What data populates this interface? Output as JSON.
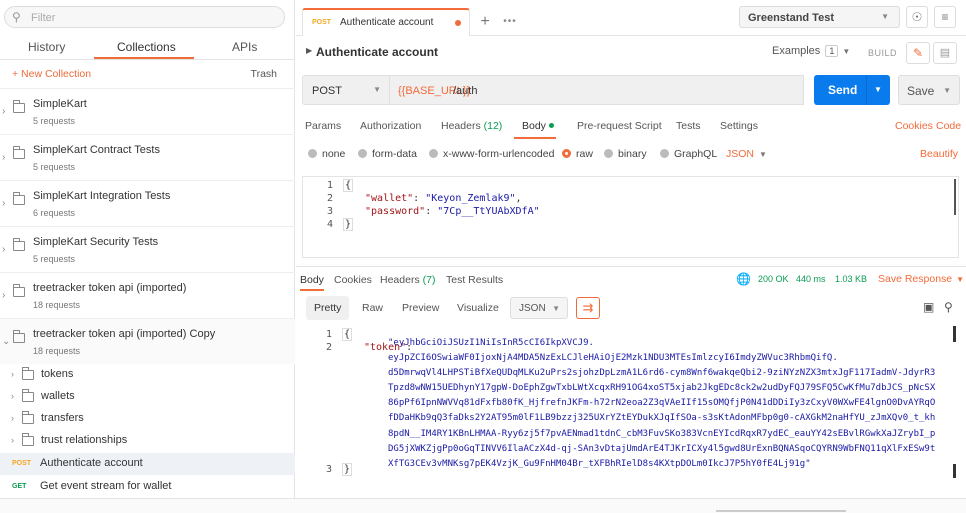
{
  "sidebar": {
    "search_placeholder": "Filter",
    "tabs": [
      "History",
      "Collections",
      "APIs"
    ],
    "new_collection": "+ New Collection",
    "trash": "Trash",
    "collections": [
      {
        "name": "SimpleKart",
        "meta": "5 requests"
      },
      {
        "name": "SimpleKart Contract Tests",
        "meta": "5 requests"
      },
      {
        "name": "SimpleKart Integration Tests",
        "meta": "6 requests"
      },
      {
        "name": "SimpleKart Security Tests",
        "meta": "5 requests"
      },
      {
        "name": "treetracker token api (imported)",
        "meta": "18 requests"
      },
      {
        "name": "treetracker token api (imported) Copy",
        "meta": "18 requests"
      }
    ],
    "folders": [
      "tokens",
      "wallets",
      "transfers",
      "trust relationships"
    ],
    "requests": [
      {
        "method": "POST",
        "name": "Authenticate account"
      },
      {
        "method": "GET",
        "name": "Get event stream for wallet"
      }
    ]
  },
  "topbar": {
    "tab_method": "POST",
    "tab_title": "Authenticate account",
    "add_tab": "+",
    "more_tabs": "•••",
    "environment": "Greenstand Test"
  },
  "request": {
    "title": "Authenticate account",
    "examples_label": "Examples",
    "examples_count": "1",
    "build_label": "BUILD",
    "method": "POST",
    "url_var": "{{BASE_URL}}",
    "url_path": "/auth",
    "send": "Send",
    "save": "Save",
    "tabs": {
      "params": "Params",
      "authorization": "Authorization",
      "headers": "Headers",
      "headers_count": "(12)",
      "body": "Body",
      "prerequest": "Pre-request Script",
      "tests": "Tests",
      "settings": "Settings",
      "cookies": "Cookies",
      "code": "Code"
    },
    "body_types": {
      "none": "none",
      "form_data": "form-data",
      "urlencoded": "x-www-form-urlencoded",
      "raw": "raw",
      "binary": "binary",
      "graphql": "GraphQL",
      "format": "JSON",
      "beautify": "Beautify"
    },
    "body_lines": {
      "l1": "{",
      "l2_key": "\"wallet\"",
      "l2_val": "\"Keyon_Zemlak9\"",
      "l3_key": "\"password\"",
      "l3_val": "\"7Cp__TtYUAbXDfA\"",
      "l4": "}",
      "n1": "1",
      "n2": "2",
      "n3": "3",
      "n4": "4"
    }
  },
  "response": {
    "tabs": {
      "body": "Body",
      "cookies": "Cookies",
      "headers": "Headers",
      "headers_count": "(7)",
      "test_results": "Test Results"
    },
    "status": "200 OK",
    "time": "440 ms",
    "size": "1.03 KB",
    "save_response": "Save Response",
    "views": {
      "pretty": "Pretty",
      "raw": "Raw",
      "preview": "Preview",
      "visualize": "Visualize",
      "format": "JSON"
    },
    "lines": {
      "n1": "1",
      "n2": "2",
      "n3": "3",
      "l1": "{",
      "token_key": "\"token\"",
      "token_val": "\"eyJhbGciOiJSUzI1NiIsInR5cCI6IkpXVCJ9.\neyJpZCI6OSwiaWF0IjoxNjA4MDA5NzExLCJleHAiOjE2Mzk1NDU3MTEsImlzcyI6ImdyZWVuc3RhbmQifQ.\nd5DmrwqVl4LHPSTiBfXeQUDqMLKu2uPrs2sjohzDpLzmA1L6rd6-cym8Wnf6wakqeQbi2-9ziNYzNZX3mtxJgF117IadmV-JdyrR3\nTpzd8wNW15UEDhynY17gpW-DoEphZgwTxbLWtXcqxRH91OG4xoST5xjab2JkgEDc8ck2w2udDyFQJ79SFQ5CwKfMu7dbJCS_pNcSX\n86pPf6IpnNWVVq81dFxfb80fK_HjfrefnJKFm-h72rN2eoa2Z3qVAeIIf15sOMQfjP0N41dDDiIy3zCxyV0WXwFE4lgnO0DvAYRqO\nfDDaHKb9qQ3faDks2Y2AT95m0lF1LB9bzzj325UXrYZtEYDukXJqIfSOa-s3sKtAdonMFbp0g0-cAXGkM2naHfYU_zJmXQv0_t_kh\n8pdN__IM4RY1KBnLHMAA-Ryy6zj5f7pvAENmad1tdnC_cbM3FuvSKo383VcnEYIcdRqxR7ydEC_eauYY42sEBvlRGwkXaJZrybI_p\nDG5jXWKZjgPp0oGqTINVV6IlaACzX4d-qj-SAn3vDtajUmdArE4TJKrICXy4l5gwd8UrExnBQNASqoCQYRN9WbFNQ11qXlFxESw9t\nXfTG3CEv3vMNKsg7pEK4VzjK_Gu9FnHM04Br_tXFBhRIelD8s4KXtpDOLm0IkcJ7P5hY0fE4Lj91g\"",
      "l3": "}"
    }
  },
  "colors": {
    "accent": "#f26b3a",
    "send": "#097bed",
    "success": "#0a9e52",
    "post": "#f5a623"
  }
}
